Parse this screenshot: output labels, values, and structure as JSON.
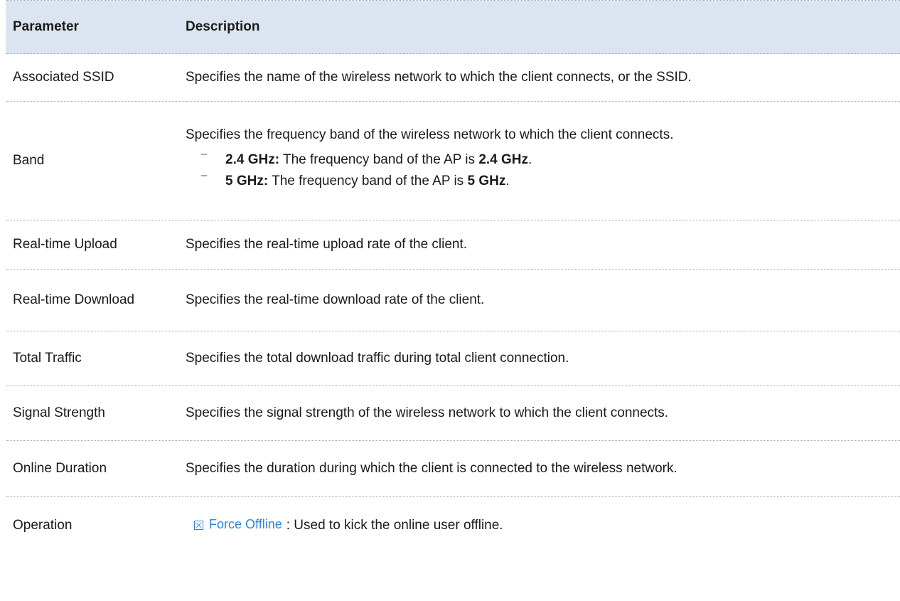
{
  "table": {
    "headers": {
      "parameter": "Parameter",
      "description": "Description"
    },
    "rows": [
      {
        "name": "Associated SSID",
        "description": "Specifies the name of the wireless network to which the client connects, or the SSID."
      },
      {
        "name": "Band",
        "description": "Specifies the frequency band of the wireless network to which the client connects.",
        "list_marker": "–",
        "items": [
          {
            "bold_label": "2.4 GHz:",
            "text": " The frequency band of the AP is ",
            "bold_value": "2.4 GHz",
            "suffix": "."
          },
          {
            "bold_label": "5 GHz:",
            "text": " The frequency band of the AP is ",
            "bold_value": "5 GHz",
            "suffix": "."
          }
        ]
      },
      {
        "name": "Real-time Upload",
        "description": "Specifies the real-time upload rate of the client."
      },
      {
        "name": "Real-time Download",
        "description": "Specifies the real-time download rate of the client."
      },
      {
        "name": "Total Traffic",
        "description": "Specifies the total download traffic during total client connection."
      },
      {
        "name": "Signal Strength",
        "description": "Specifies the signal strength of the wireless network to which the client connects."
      },
      {
        "name": "Online Duration",
        "description": "Specifies the duration during which the client is connected to the wireless network."
      },
      {
        "name": "Operation",
        "button_label": "Force Offline",
        "button_icon": "close-box-icon",
        "description": ": Used to kick the online user offline."
      }
    ]
  },
  "colors": {
    "header_background": "#dbe5f1",
    "link_blue": "#2e86de",
    "text": "#1a1a1a"
  }
}
